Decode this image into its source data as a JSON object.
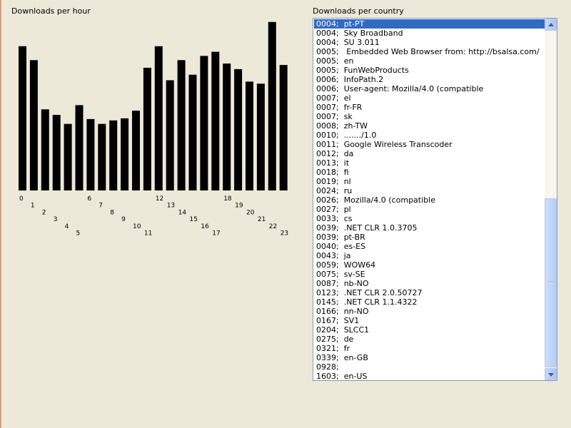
{
  "hour_panel": {
    "title": "Downloads per hour"
  },
  "country_panel": {
    "title": "Downloads per country",
    "selected_index": 0,
    "items": [
      "0004;  pt-PT",
      "0004;  Sky Broadband",
      "0004;  SU 3.011",
      "0005;   Embedded Web Browser from: http://bsalsa.com/",
      "0005;  en",
      "0005;  FunWebProducts",
      "0006;  InfoPath.2",
      "0006;  User-agent: Mozilla/4.0 (compatible",
      "0007;  el",
      "0007;  fr-FR",
      "0007;  sk",
      "0008;  zh-TW",
      "0010;  ......./1.0",
      "0011;  Google Wireless Transcoder",
      "0012;  da",
      "0013;  it",
      "0018;  fi",
      "0019;  nl",
      "0024;  ru",
      "0026;  Mozilla/4.0 (compatible",
      "0027;  pl",
      "0033;  cs",
      "0039;  .NET CLR 1.0.3705",
      "0039;  pt-BR",
      "0040;  es-ES",
      "0043;  ja",
      "0059;  WOW64",
      "0075;  sv-SE",
      "0087;  nb-NO",
      "0123;  .NET CLR 2.0.50727",
      "0145;  .NET CLR 1.1.4322",
      "0166;  nn-NO",
      "0167;  SV1",
      "0204;  SLCC1",
      "0275;  de",
      "0321;  fr",
      "0339;  en-GB",
      "0928;",
      "1603;  en-US"
    ],
    "scroll_position": 0.5,
    "visible_fraction": 0.5,
    "icons": {
      "up": "scroll-up-arrow-icon",
      "down": "scroll-down-arrow-icon",
      "grip": "scrollbar-grip-icon"
    }
  },
  "chart_data": {
    "type": "bar",
    "title": "Downloads per hour",
    "xlabel": "",
    "ylabel": "",
    "categories": [
      "0",
      "1",
      "2",
      "3",
      "4",
      "5",
      "6",
      "7",
      "8",
      "9",
      "10",
      "11",
      "12",
      "13",
      "14",
      "15",
      "16",
      "17",
      "18",
      "19",
      "20",
      "21",
      "22",
      "23"
    ],
    "values": [
      208,
      188,
      117,
      109,
      96,
      123,
      103,
      96,
      101,
      104,
      115,
      177,
      208,
      159,
      188,
      167,
      194,
      200,
      183,
      175,
      157,
      154,
      243,
      181
    ],
    "ylim": [
      0,
      250
    ],
    "grid": false,
    "bar_color": "#000000",
    "label_layout": "staggered-diagonal"
  },
  "colors": {
    "window_bg": "#ece9d8",
    "list_border": "#7f9db9",
    "selection_bg": "#316ac5",
    "selection_fg": "#ffffff"
  }
}
